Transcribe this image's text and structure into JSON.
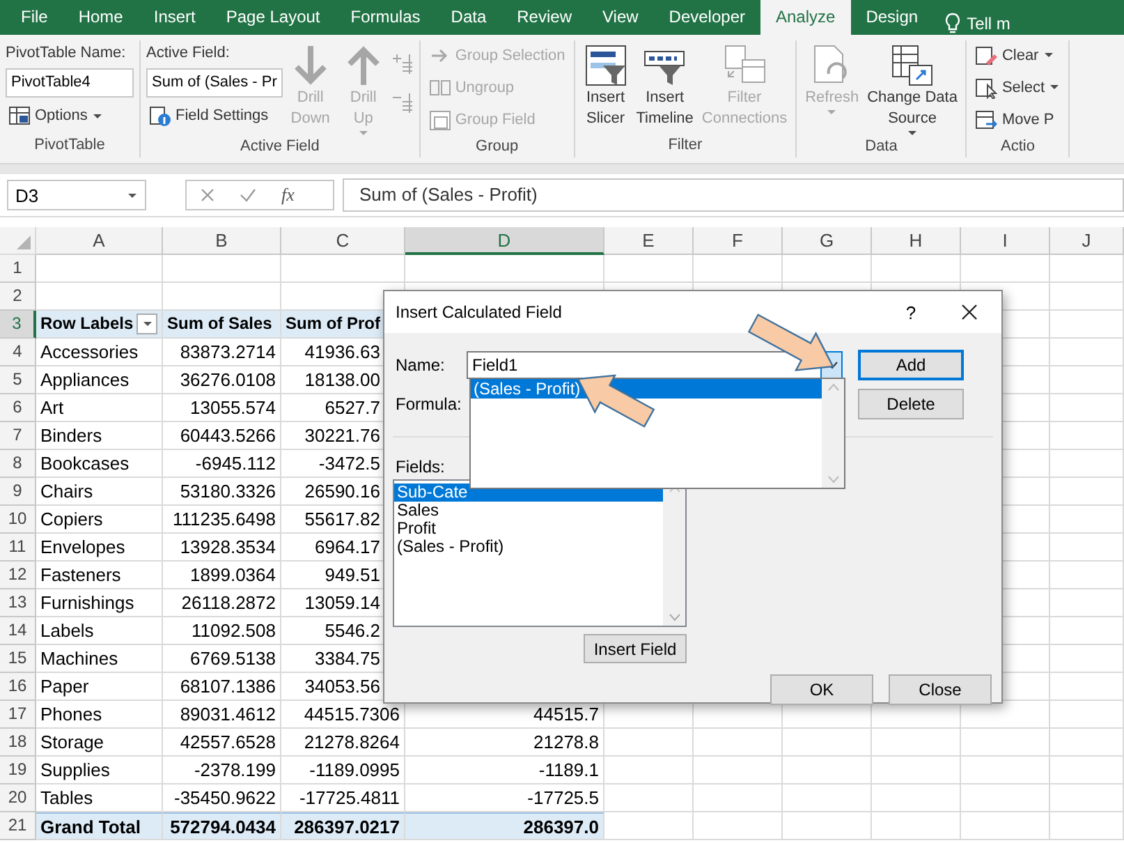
{
  "tabs": [
    {
      "label": "File",
      "selected": false
    },
    {
      "label": "Home",
      "selected": false
    },
    {
      "label": "Insert",
      "selected": false
    },
    {
      "label": "Page Layout",
      "selected": false
    },
    {
      "label": "Formulas",
      "selected": false
    },
    {
      "label": "Data",
      "selected": false
    },
    {
      "label": "Review",
      "selected": false
    },
    {
      "label": "View",
      "selected": false
    },
    {
      "label": "Developer",
      "selected": false
    },
    {
      "label": "Analyze",
      "selected": true
    },
    {
      "label": "Design",
      "selected": false
    }
  ],
  "tell_me": "Tell m",
  "ribbon_groups": [
    {
      "label": "PivotTable",
      "columns": [
        [
          {
            "kind": "label",
            "text": "PivotTable Name:"
          },
          {
            "kind": "input",
            "value": "PivotTable4"
          },
          {
            "kind": "small",
            "label": "Options",
            "disabled": false,
            "caret": true
          }
        ]
      ]
    },
    {
      "label": "Active Field",
      "columns": [
        [
          {
            "kind": "label",
            "text": "Active Field:"
          },
          {
            "kind": "input",
            "value": "Sum of (Sales - Pr"
          },
          {
            "kind": "small",
            "label": "Field Settings",
            "disabled": false,
            "caret": false
          }
        ],
        [
          {
            "kind": "large",
            "label": "Drill\nDown",
            "disabled": true,
            "caret": false
          }
        ],
        [
          {
            "kind": "large",
            "label": "Drill\nUp",
            "disabled": true,
            "caret": true
          }
        ],
        [
          {
            "kind": "icon",
            "disabled": true
          },
          {
            "kind": "icon",
            "disabled": true
          }
        ]
      ]
    },
    {
      "label": "Group",
      "columns": [
        [
          {
            "kind": "small",
            "label": "Group Selection",
            "disabled": true,
            "caret": false
          },
          {
            "kind": "small",
            "label": "Ungroup",
            "disabled": true,
            "caret": false
          },
          {
            "kind": "small",
            "label": "Group Field",
            "disabled": true,
            "caret": false
          }
        ]
      ]
    },
    {
      "label": "Filter",
      "columns": [
        [
          {
            "kind": "large",
            "label": "Insert\nSlicer",
            "disabled": false,
            "caret": false
          }
        ],
        [
          {
            "kind": "large",
            "label": "Insert\nTimeline",
            "disabled": false,
            "caret": false
          }
        ],
        [
          {
            "kind": "large",
            "label": "Filter\nConnections",
            "disabled": true,
            "caret": false
          }
        ]
      ]
    },
    {
      "label": "Data",
      "columns": [
        [
          {
            "kind": "large",
            "label": "Refresh",
            "disabled": true,
            "caret": true
          }
        ],
        [
          {
            "kind": "large",
            "label": "Change Data\nSource",
            "disabled": false,
            "caret": true
          }
        ]
      ]
    },
    {
      "label": "Actio",
      "columns": [
        [
          {
            "kind": "small",
            "label": "Clear",
            "disabled": false,
            "caret": true
          },
          {
            "kind": "small",
            "label": "Select",
            "disabled": false,
            "caret": true
          },
          {
            "kind": "small",
            "label": "Move P",
            "disabled": false,
            "caret": false
          }
        ]
      ]
    }
  ],
  "name_box": "D3",
  "function_button": "fx",
  "formula": "Sum of (Sales - Profit)",
  "columns": [
    {
      "label": "A",
      "selected": false
    },
    {
      "label": "B",
      "selected": false
    },
    {
      "label": "C",
      "selected": false
    },
    {
      "label": "D",
      "selected": true
    },
    {
      "label": "E",
      "selected": false
    },
    {
      "label": "F",
      "selected": false
    },
    {
      "label": "G",
      "selected": false
    },
    {
      "label": "H",
      "selected": false
    },
    {
      "label": "I",
      "selected": false
    },
    {
      "label": "J",
      "selected": false
    }
  ],
  "rows": [
    {
      "number": "1",
      "selected": false,
      "kind": "blank",
      "cells": []
    },
    {
      "number": "2",
      "selected": false,
      "kind": "blank",
      "cells": []
    },
    {
      "number": "3",
      "selected": true,
      "kind": "header",
      "cells": [
        "Row Labels",
        "Sum of Sales",
        "Sum of Prof"
      ]
    },
    {
      "number": "4",
      "selected": false,
      "kind": "data",
      "cells": [
        "Accessories",
        "83873.2714",
        "41936.63"
      ]
    },
    {
      "number": "5",
      "selected": false,
      "kind": "data",
      "cells": [
        "Appliances",
        "36276.0108",
        "18138.00"
      ]
    },
    {
      "number": "6",
      "selected": false,
      "kind": "data",
      "cells": [
        "Art",
        "13055.574",
        "6527.7"
      ]
    },
    {
      "number": "7",
      "selected": false,
      "kind": "data",
      "cells": [
        "Binders",
        "60443.5266",
        "30221.76"
      ]
    },
    {
      "number": "8",
      "selected": false,
      "kind": "data",
      "cells": [
        "Bookcases",
        "-6945.112",
        "-3472.5"
      ]
    },
    {
      "number": "9",
      "selected": false,
      "kind": "data",
      "cells": [
        "Chairs",
        "53180.3326",
        "26590.16"
      ]
    },
    {
      "number": "10",
      "selected": false,
      "kind": "data",
      "cells": [
        "Copiers",
        "111235.6498",
        "55617.82"
      ]
    },
    {
      "number": "11",
      "selected": false,
      "kind": "data",
      "cells": [
        "Envelopes",
        "13928.3534",
        "6964.17"
      ]
    },
    {
      "number": "12",
      "selected": false,
      "kind": "data",
      "cells": [
        "Fasteners",
        "1899.0364",
        "949.51"
      ]
    },
    {
      "number": "13",
      "selected": false,
      "kind": "data",
      "cells": [
        "Furnishings",
        "26118.2872",
        "13059.14"
      ]
    },
    {
      "number": "14",
      "selected": false,
      "kind": "data",
      "cells": [
        "Labels",
        "11092.508",
        "5546.2"
      ]
    },
    {
      "number": "15",
      "selected": false,
      "kind": "data",
      "cells": [
        "Machines",
        "6769.5138",
        "3384.75"
      ]
    },
    {
      "number": "16",
      "selected": false,
      "kind": "data",
      "cells": [
        "Paper",
        "68107.1386",
        "34053.56"
      ]
    },
    {
      "number": "17",
      "selected": false,
      "kind": "data",
      "cells": [
        "Phones",
        "89031.4612",
        "44515.7306",
        "44515.7"
      ]
    },
    {
      "number": "18",
      "selected": false,
      "kind": "data",
      "cells": [
        "Storage",
        "42557.6528",
        "21278.8264",
        "21278.8"
      ]
    },
    {
      "number": "19",
      "selected": false,
      "kind": "data",
      "cells": [
        "Supplies",
        "-2378.199",
        "-1189.0995",
        "-1189.1"
      ]
    },
    {
      "number": "20",
      "selected": false,
      "kind": "data",
      "cells": [
        "Tables",
        "-35450.9622",
        "-17725.4811",
        "-17725.5"
      ]
    },
    {
      "number": "21",
      "selected": false,
      "kind": "total",
      "cells": [
        "Grand Total",
        "572794.0434",
        "286397.0217",
        "286397.0"
      ]
    }
  ],
  "dialog": {
    "title": "Insert Calculated Field",
    "help": "?",
    "name_label": "Name:",
    "name_value": "Field1",
    "formula_label": "Formula:",
    "dropdown_items": [
      {
        "text": "(Sales - Profit)",
        "selected": true
      }
    ],
    "fields_label": "Fields:",
    "fields": [
      {
        "text": "Sub-Cate",
        "selected": true
      },
      {
        "text": "Sales",
        "selected": false
      },
      {
        "text": "Profit",
        "selected": false
      },
      {
        "text": "(Sales - Profit)",
        "selected": false
      }
    ],
    "buttons": [
      {
        "label": "Add",
        "default": true
      },
      {
        "label": "Delete",
        "default": false
      },
      {
        "label": "Insert Field",
        "default": false
      },
      {
        "label": "OK",
        "default": false
      },
      {
        "label": "Close",
        "default": false
      }
    ]
  }
}
